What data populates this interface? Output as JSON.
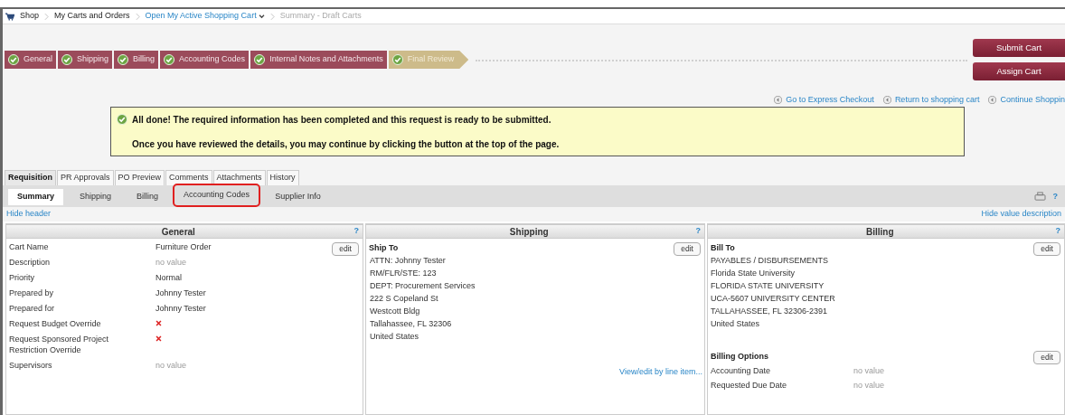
{
  "breadcrumb": [
    {
      "label": "Shop",
      "kind": "home"
    },
    {
      "label": "My Carts and Orders",
      "kind": "plain"
    },
    {
      "label": "Open My Active Shopping Cart",
      "kind": "dropdown"
    },
    {
      "label": "Summary - Draft Carts",
      "kind": "current"
    }
  ],
  "steps": [
    {
      "label": "General",
      "selected": false
    },
    {
      "label": "Shipping",
      "selected": false
    },
    {
      "label": "Billing",
      "selected": false
    },
    {
      "label": "Accounting Codes",
      "selected": false
    },
    {
      "label": "Internal Notes and Attachments",
      "selected": false
    },
    {
      "label": "Final Review",
      "selected": true
    }
  ],
  "actions": [
    "Submit Cart",
    "Assign Cart"
  ],
  "links": [
    "Go to Express Checkout",
    "Return to shopping cart",
    "Continue Shoppin"
  ],
  "notice": {
    "lines": [
      "All done! The required information has been completed and this request is ready to be submitted.",
      "Once you have reviewed the details, you may continue by clicking the button at the top of the page."
    ]
  },
  "tabs": [
    {
      "label": "Requisition",
      "selected": true
    },
    {
      "label": "PR Approvals",
      "selected": false
    },
    {
      "label": "PO Preview",
      "selected": false
    },
    {
      "label": "Comments",
      "selected": false
    },
    {
      "label": "Attachments",
      "selected": false
    },
    {
      "label": "History",
      "selected": false
    }
  ],
  "subtabs": [
    {
      "label": "Summary",
      "selected": true,
      "highlighted": false
    },
    {
      "label": "Shipping",
      "selected": false,
      "highlighted": false
    },
    {
      "label": "Billing",
      "selected": false,
      "highlighted": false
    },
    {
      "label": "Accounting Codes",
      "selected": false,
      "highlighted": true
    },
    {
      "label": "Supplier Info",
      "selected": false,
      "highlighted": false
    }
  ],
  "help_mark": "?",
  "hide_header": "Hide header",
  "hide_values": "Hide value description",
  "general": {
    "title": "General",
    "help": "?",
    "edit": "edit",
    "fields": [
      {
        "label": "Cart Name",
        "kind": "text",
        "value": "Furniture Order"
      },
      {
        "label": "Description",
        "kind": "empty",
        "value": "no value"
      },
      {
        "label": "Priority",
        "kind": "text",
        "value": "Normal"
      },
      {
        "label": "Prepared by",
        "kind": "text",
        "value": "Johnny Tester"
      },
      {
        "label": "Prepared for",
        "kind": "text",
        "value": "Johnny Tester"
      },
      {
        "label": "Request Budget Override",
        "kind": "flag",
        "on": false
      },
      {
        "label": "Request Sponsored Project Restriction Override",
        "kind": "flag",
        "on": false
      },
      {
        "label": "Supervisors",
        "kind": "empty",
        "value": "no value"
      }
    ]
  },
  "shipping": {
    "title": "Shipping",
    "help": "?",
    "heading": "Ship To",
    "edit": "edit",
    "address": [
      "ATTN: Johnny Tester",
      "RM/FLR/STE: 123",
      "DEPT: Procurement Services",
      "222 S Copeland St",
      "Westcott Bldg",
      "Tallahassee, FL 32306",
      "United States"
    ],
    "link": "View/edit by line item..."
  },
  "billing": {
    "title": "Billing",
    "help": "?",
    "heading": "Bill To",
    "edit": "edit",
    "address": [
      "PAYABLES / DISBURSEMENTS",
      "Florida State University",
      "FLORIDA STATE UNIVERSITY",
      "UCA-5607 UNIVERSITY CENTER",
      "TALLAHASSEE, FL 32306-2391",
      "United States"
    ],
    "options_heading": "Billing Options",
    "options_edit": "edit",
    "options": [
      {
        "label": "Accounting Date",
        "kind": "empty",
        "value": "no value"
      },
      {
        "label": "Requested Due Date",
        "kind": "empty",
        "value": "no value"
      }
    ]
  }
}
